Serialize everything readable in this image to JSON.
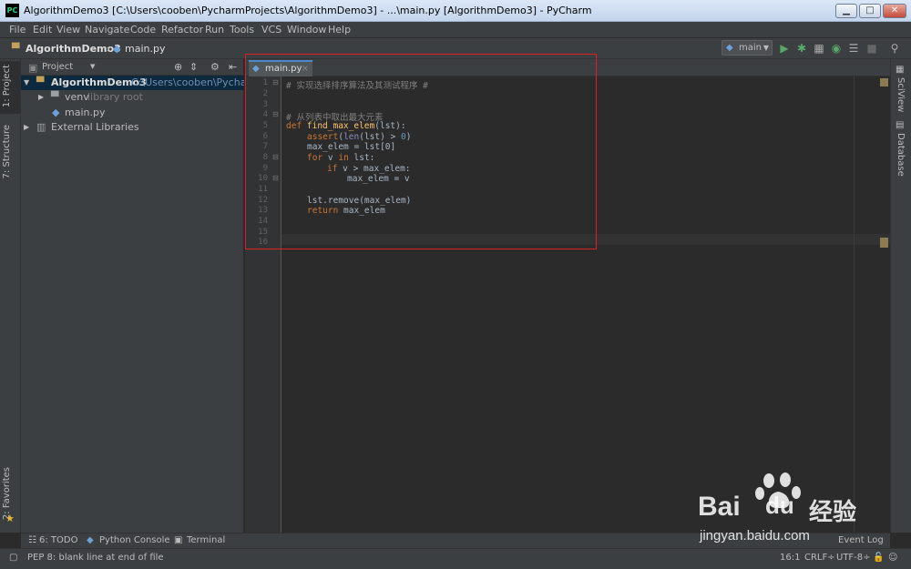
{
  "window": {
    "title": "AlgorithmDemo3 [C:\\Users\\cooben\\PycharmProjects\\AlgorithmDemo3] - ...\\main.py [AlgorithmDemo3] - PyCharm",
    "app_icon": "PC",
    "minimize": "▁",
    "maximize": "□",
    "close": "✕"
  },
  "menu": [
    "File",
    "Edit",
    "View",
    "Navigate",
    "Code",
    "Refactor",
    "Run",
    "Tools",
    "VCS",
    "Window",
    "Help"
  ],
  "nav": {
    "project": "AlgorithmDemo3",
    "file": "main.py",
    "run_config": "main"
  },
  "left_tabs": {
    "project": "1: Project",
    "structure": "7: Structure",
    "favorites": "2: Favorites"
  },
  "right_tabs": {
    "sciview": "SciView",
    "database": "Database"
  },
  "project_panel": {
    "header": "Project",
    "tree": [
      {
        "label": "AlgorithmDemo3",
        "hint": "C:\\Users\\cooben\\PycharmP"
      },
      {
        "label": "venv",
        "hint": "library root"
      },
      {
        "label": "main.py",
        "hint": ""
      },
      {
        "label": "External Libraries",
        "hint": ""
      }
    ]
  },
  "editor": {
    "tab": "main.py",
    "close": "×",
    "lines": [
      "1",
      "2",
      "3",
      "4",
      "5",
      "6",
      "7",
      "8",
      "9",
      "10",
      "11",
      "12",
      "13",
      "14",
      "15",
      "16"
    ],
    "code": {
      "l1": "# 实现选择排序算法及其测试程序 #",
      "l4": "# 从列表中取出最大元素",
      "l5_def": "def ",
      "l5_fn": "find_max_elem",
      "l5_rest": "(lst):",
      "l6_kw": "assert",
      "l6_bi": "len",
      "l6_a": "(",
      "l6_b": "(lst) > ",
      "l6_num": "0",
      "l6_c": ")",
      "l7": "max_elem = lst[0]",
      "l8_for": "for ",
      "l8_v": "v ",
      "l8_in": "in ",
      "l8_lst": "lst:",
      "l9_if": "if ",
      "l9_rest": "v > max_elem:",
      "l10": "max_elem = v",
      "l12": "lst.remove(max_elem)",
      "l13_kw": "return ",
      "l13_rest": "max_elem"
    }
  },
  "bottom_tabs": {
    "todo": "6: TODO",
    "console": "Python Console",
    "terminal": "Terminal"
  },
  "status": {
    "message": "PEP 8: blank line at end of file",
    "event_log": "Event Log",
    "position": "16:1",
    "line_sep": "CRLF÷",
    "encoding": "UTF-8÷"
  },
  "watermark": {
    "brand": "Bai",
    "brand2": "du",
    "cn": "经验",
    "url": "jingyan.baidu.com"
  },
  "colors": {
    "keyword": "#cc7832",
    "function": "#ffc66d",
    "number": "#6897bb",
    "builtin": "#8888c6",
    "comment": "#808080",
    "annotation_box": "#e02020"
  }
}
